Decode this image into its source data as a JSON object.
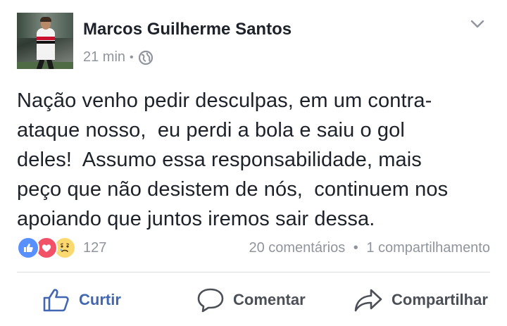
{
  "post": {
    "author": "Marcos Guilherme Santos",
    "time": "21 min",
    "separator": "•",
    "privacy_icon": "globe-icon",
    "text_lines": [
      "Nação venho pedir desculpas, em um contra-",
      "ataque nosso,  eu perdi a bola e saiu o gol",
      "deles!  Assumo essa responsabilidade, mais",
      "peço que não desistem de nós,  continuem nos",
      "apoiando que juntos iremos sair dessa."
    ]
  },
  "stats": {
    "reaction_icons": [
      "like-reaction-icon",
      "love-reaction-icon",
      "sad-reaction-icon"
    ],
    "reaction_count": "127",
    "comments": "20 comentários",
    "separator": "•",
    "shares": "1 compartilhamento"
  },
  "actions": {
    "like_label": "Curtir",
    "comment_label": "Comentar",
    "share_label": "Compartilhar"
  },
  "colors": {
    "like_blue": "#4267b2",
    "secondary_text": "#90949c",
    "primary_text": "#1d2129"
  }
}
